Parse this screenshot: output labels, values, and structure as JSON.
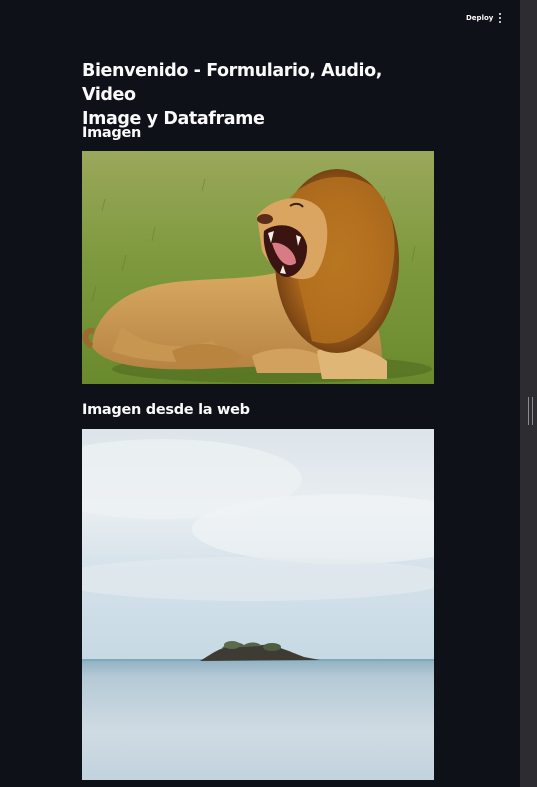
{
  "header": {
    "deploy_label": "Deploy",
    "menu_icon": "vertical-ellipsis-icon"
  },
  "main": {
    "title_line1": "Bienvenido - Formulario, Audio, Video",
    "title_line2": "Image y Dataframe",
    "sections": [
      {
        "subheader": "Imagen",
        "image": "lion-photo"
      },
      {
        "subheader": "Imagen desde la web",
        "image": "island-seascape-photo"
      }
    ]
  },
  "theme": {
    "background": "#0e1117",
    "text": "#fafafa",
    "scrollbar_track": "#2c2c31"
  }
}
